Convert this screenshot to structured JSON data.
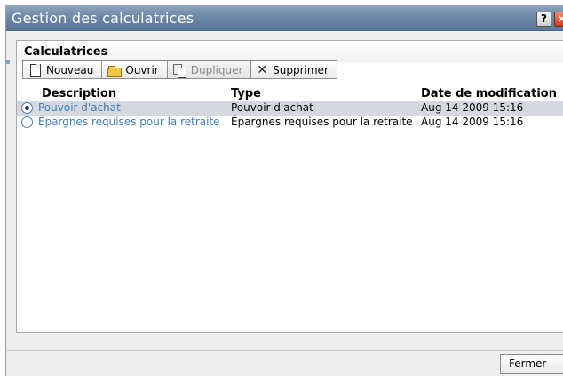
{
  "window": {
    "title": "Gestion des calculatrices",
    "help_label": "?",
    "close_label": "×"
  },
  "panel": {
    "title": "Calculatrices"
  },
  "toolbar": {
    "new_label": "Nouveau",
    "open_label": "Ouvrir",
    "duplicate_label": "Dupliquer",
    "delete_label": "Supprimer",
    "delete_icon": "✕"
  },
  "table": {
    "columns": {
      "description": "Description",
      "type": "Type",
      "date": "Date de modification"
    },
    "rows": [
      {
        "description": "Pouvoir d'achat",
        "type": "Pouvoir d'achat",
        "date": "Aug 14 2009 15:16",
        "selected": true
      },
      {
        "description": "Épargnes requises pour la retraite",
        "type": "Épargnes requises pour la retraite",
        "date": "Aug 14 2009 15:16",
        "selected": false
      }
    ]
  },
  "footer": {
    "close_label": "Fermer"
  },
  "colors": {
    "titlebar": "#6e88a8",
    "link": "#3e7fb6",
    "selected_row": "#d5d8de"
  }
}
